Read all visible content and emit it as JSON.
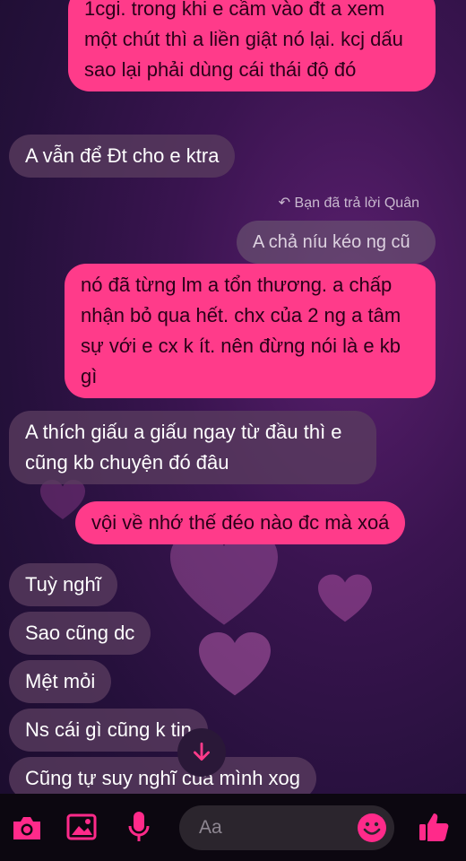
{
  "messages": [
    {
      "dir": "out",
      "text": "1cgi. trong khi e cầm vào đt a xem một chút thì a liền giật nó lại. kcj dấu sao lại phải dùng cái thái độ đó"
    },
    {
      "dir": "in",
      "text": "A vẫn để Đt cho e ktra"
    },
    {
      "dir": "reply_meta",
      "text": "Bạn đã trả lời Quân"
    },
    {
      "dir": "quoted",
      "text": "A chả níu kéo ng cũ"
    },
    {
      "dir": "out",
      "text": "nó đã từng lm a tổn thương. a chấp nhận bỏ qua hết. chx của 2 ng a tâm sự với e cx k ít. nên đừng nói là e kb gì"
    },
    {
      "dir": "in",
      "text": "A thích giấu a giấu ngay từ đầu thì e cũng kb chuyện đó đâu"
    },
    {
      "dir": "out",
      "text": "vội về nhớ thế đéo nào đc mà xoá"
    },
    {
      "dir": "in",
      "text": "Tuỳ nghĩ"
    },
    {
      "dir": "in",
      "text": "Sao cũng dc"
    },
    {
      "dir": "in",
      "text": "Mệt mỏi"
    },
    {
      "dir": "in",
      "text": "Ns cái gì cũng k tin"
    },
    {
      "dir": "in",
      "text": "Cũng tự suy nghĩ của mình xog"
    }
  ],
  "composer": {
    "placeholder": "Aa"
  },
  "icons": {
    "camera": "camera-icon",
    "gallery": "image-icon",
    "mic": "microphone-icon",
    "emoji": "emoji-icon",
    "like": "thumbs-up-icon",
    "scroll": "arrow-down-icon",
    "reply": "reply-arrow-icon"
  },
  "colors": {
    "outgoing": "#ff3b8a",
    "incoming": "#5a3c5f",
    "accent": "#ff2a8a"
  }
}
